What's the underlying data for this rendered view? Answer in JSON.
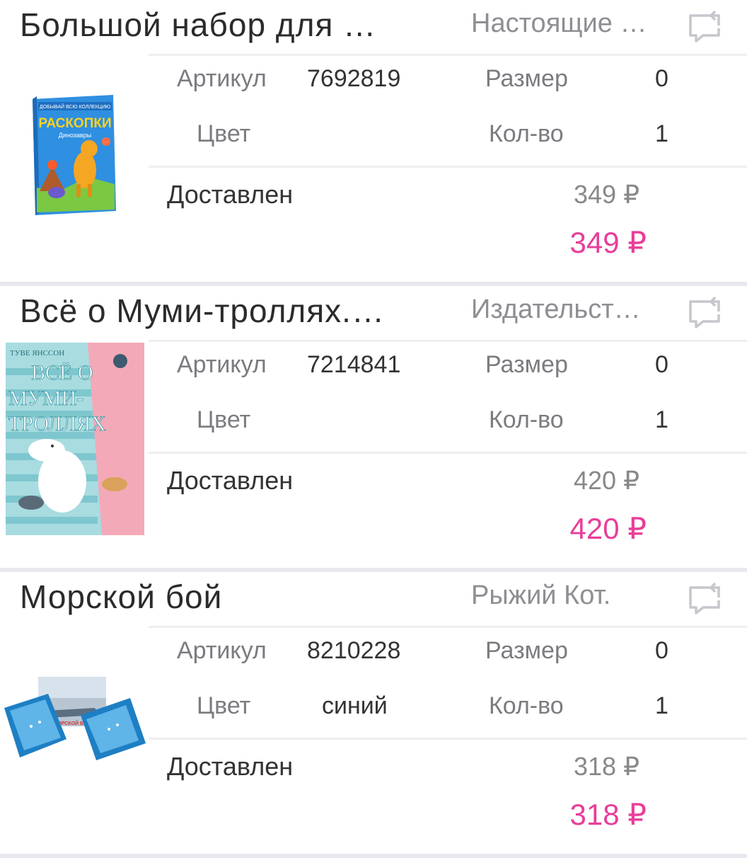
{
  "orders": [
    {
      "title": "Большой набор для …",
      "brand": "Настоящие …",
      "article_label": "Артикул",
      "article": "7692819",
      "size_label": "Размер",
      "size": "0",
      "color_label": "Цвет",
      "color": "",
      "qty_label": "Кол-во",
      "qty": "1",
      "status": "Доставлен",
      "price_old": "349 ₽",
      "price": "349 ₽",
      "image": {
        "header": "ДОБЫВАЙ ВСЮ КОЛЛЕКЦИЮ",
        "title": "РАСКОПКИ",
        "subtitle": "Динозавры"
      }
    },
    {
      "title": "Всё о Муми-троллях.…",
      "brand": "Издательст…",
      "article_label": "Артикул",
      "article": "7214841",
      "size_label": "Размер",
      "size": "0",
      "color_label": "Цвет",
      "color": "",
      "qty_label": "Кол-во",
      "qty": "1",
      "status": "Доставлен",
      "price_old": "420 ₽",
      "price": "420 ₽",
      "image": {
        "author": "ТУВЕ ЯНССОН",
        "title_line1": "ВСЁ О",
        "title_line2": "МУМИ-",
        "title_line3": "ТРОЛЛЯХ"
      }
    },
    {
      "title": "Морской бой",
      "brand": "Рыжий Кот.",
      "article_label": "Артикул",
      "article": "8210228",
      "size_label": "Размер",
      "size": "0",
      "color_label": "Цвет",
      "color": "синий",
      "qty_label": "Кол-во",
      "qty": "1",
      "status": "Доставлен",
      "price_old": "318 ₽",
      "price": "318 ₽",
      "image": {
        "title": "МОРСКОЙ БОЙ"
      }
    }
  ],
  "colors": {
    "price_accent": "#e83e9a",
    "divider": "#e8e9ee"
  }
}
